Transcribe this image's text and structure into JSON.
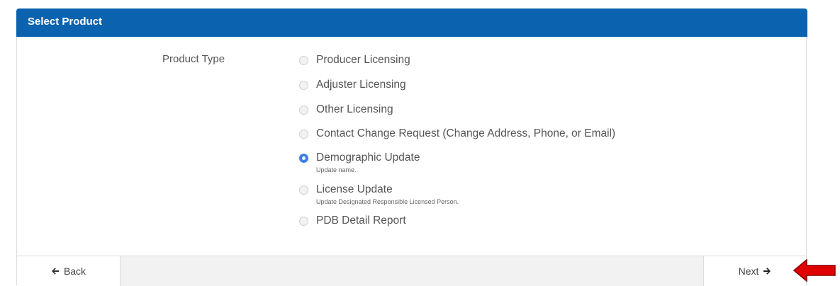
{
  "panel": {
    "title": "Select Product"
  },
  "form": {
    "field_label": "Product Type",
    "options": [
      {
        "label": "Producer Licensing",
        "help": "",
        "checked": false
      },
      {
        "label": "Adjuster Licensing",
        "help": "",
        "checked": false
      },
      {
        "label": "Other Licensing",
        "help": "",
        "checked": false
      },
      {
        "label": "Contact Change Request (Change Address, Phone, or Email)",
        "help": "",
        "checked": false
      },
      {
        "label": "Demographic Update",
        "help": "Update name.",
        "checked": true
      },
      {
        "label": "License Update",
        "help": "Update Designated Responsible Licensed Person.",
        "checked": false
      },
      {
        "label": "PDB Detail Report",
        "help": "",
        "checked": false
      }
    ]
  },
  "footer": {
    "back_label": "Back",
    "next_label": "Next",
    "back_icon": "arrow-left-icon",
    "next_icon": "arrow-right-icon"
  },
  "colors": {
    "header": "#0b63b0",
    "radio_selected": "#3f7fe8",
    "annotation_arrow": "#e00000"
  }
}
